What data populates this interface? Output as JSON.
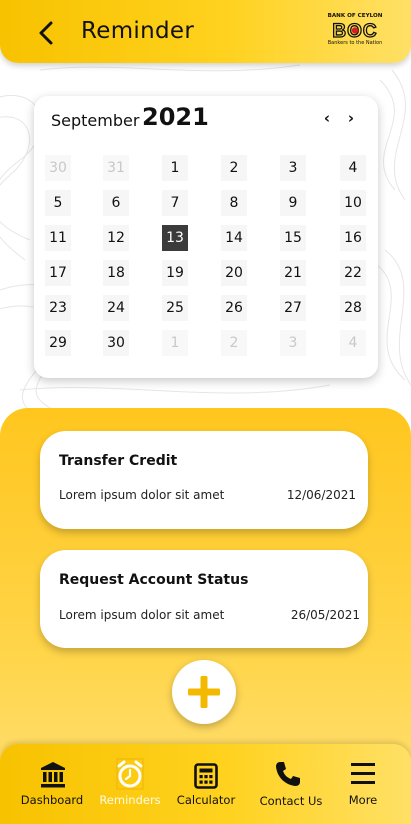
{
  "header": {
    "title": "Reminder",
    "logo_top": "BANK OF CEYLON",
    "logo_mark": "BOC",
    "logo_tagline": "Bankers to the Nation"
  },
  "calendar": {
    "month": "September",
    "year": "2021",
    "prev": "‹",
    "next": "›",
    "days": [
      {
        "label": "30",
        "muted": true
      },
      {
        "label": "31",
        "muted": true
      },
      {
        "label": "1"
      },
      {
        "label": "2"
      },
      {
        "label": "3"
      },
      {
        "label": "4"
      },
      {
        "label": "5"
      },
      {
        "label": "6"
      },
      {
        "label": "7"
      },
      {
        "label": "8"
      },
      {
        "label": "9"
      },
      {
        "label": "10"
      },
      {
        "label": "11"
      },
      {
        "label": "12"
      },
      {
        "label": "13",
        "selected": true
      },
      {
        "label": "14"
      },
      {
        "label": "15"
      },
      {
        "label": "16"
      },
      {
        "label": "17"
      },
      {
        "label": "18"
      },
      {
        "label": "19"
      },
      {
        "label": "20"
      },
      {
        "label": "21"
      },
      {
        "label": "22"
      },
      {
        "label": "23"
      },
      {
        "label": "24"
      },
      {
        "label": "25"
      },
      {
        "label": "26"
      },
      {
        "label": "27"
      },
      {
        "label": "28"
      },
      {
        "label": "29"
      },
      {
        "label": "30"
      },
      {
        "label": "1",
        "muted": true
      },
      {
        "label": "2",
        "muted": true
      },
      {
        "label": "3",
        "muted": true
      },
      {
        "label": "4",
        "muted": true
      }
    ]
  },
  "reminders": [
    {
      "title": "Transfer Credit",
      "description": "Lorem ipsum dolor sit amet",
      "date": "12/06/2021"
    },
    {
      "title": "Request Account Status",
      "description": "Lorem ipsum dolor sit amet",
      "date": "26/05/2021"
    }
  ],
  "add_button": {
    "icon": "plus-icon"
  },
  "nav": {
    "items": [
      {
        "label": "Dashboard",
        "icon": "bank-icon"
      },
      {
        "label": "Reminders",
        "icon": "alarm-clock-icon",
        "active": true
      },
      {
        "label": "Calculator",
        "icon": "calculator-icon"
      },
      {
        "label": "Contact Us",
        "icon": "phone-icon"
      },
      {
        "label": "More",
        "icon": "menu-icon"
      }
    ]
  },
  "colors": {
    "accent_yellow": "#ffc61e",
    "selected_day": "#3b3b3b",
    "plus": "#f5b800"
  }
}
